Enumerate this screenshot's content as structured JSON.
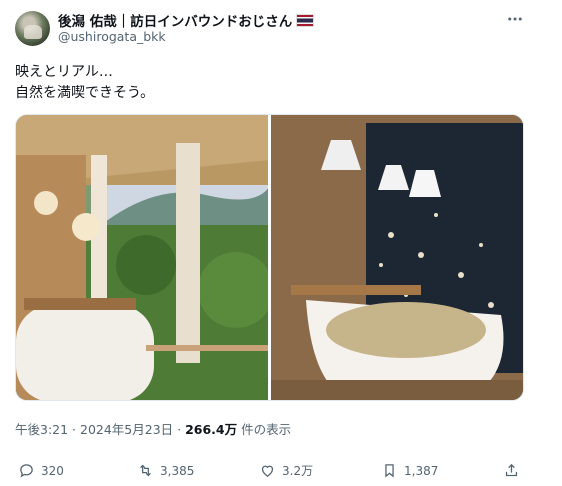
{
  "author": {
    "name": "後潟 佑哉｜訪日インバウンドおじさん",
    "handle": "@ushirogata_bkk",
    "flag_icon": "thailand-flag-icon"
  },
  "menu_icon": "more-icon",
  "post": {
    "lines": [
      "映えとリアル…",
      "自然を満喫できそう。"
    ]
  },
  "media": [
    {
      "description_icon": "photo-balcony-bathtub"
    },
    {
      "description_icon": "photo-indoor-bathtub"
    }
  ],
  "meta": {
    "time": "午後3:21",
    "sep1": " · ",
    "date": "2024年5月23日",
    "sep2": " · ",
    "views": "266.4万",
    "views_suffix": " 件の表示"
  },
  "actions": {
    "reply": "320",
    "repost": "3,385",
    "like": "3.2万",
    "bookmark": "1,387"
  }
}
